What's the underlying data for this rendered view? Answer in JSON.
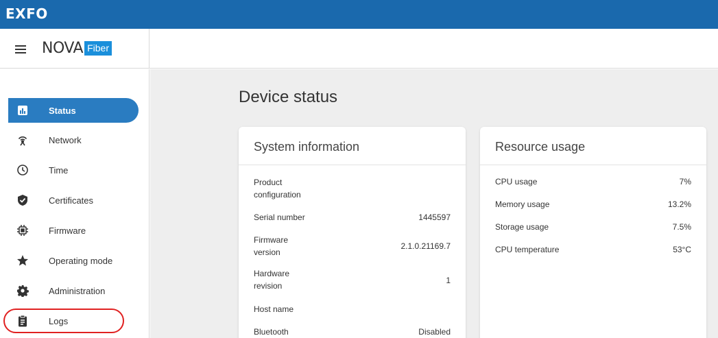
{
  "topbar": {
    "brand": "EXFO"
  },
  "header": {
    "logo_nova": "NOVA",
    "logo_fiber": "Fiber"
  },
  "sidebar": {
    "items": [
      {
        "label": "Status",
        "icon": "bar-chart-icon"
      },
      {
        "label": "Network",
        "icon": "antenna-icon"
      },
      {
        "label": "Time",
        "icon": "clock-icon"
      },
      {
        "label": "Certificates",
        "icon": "shield-check-icon"
      },
      {
        "label": "Firmware",
        "icon": "chip-icon"
      },
      {
        "label": "Operating mode",
        "icon": "star-icon"
      },
      {
        "label": "Administration",
        "icon": "gear-icon"
      },
      {
        "label": "Logs",
        "icon": "clipboard-icon"
      }
    ],
    "active_index": 0
  },
  "main": {
    "title": "Device status",
    "system": {
      "title": "System information",
      "rows": [
        {
          "label": "Product configuration",
          "value": ""
        },
        {
          "label": "Serial number",
          "value": "1445597"
        },
        {
          "label": "Firmware version",
          "value": "2.1.0.21169.7"
        },
        {
          "label": "Hardware revision",
          "value": "1"
        },
        {
          "label": "Host name",
          "value": ""
        },
        {
          "label": "Bluetooth",
          "value": "Disabled"
        }
      ]
    },
    "resource": {
      "title": "Resource usage",
      "rows": [
        {
          "label": "CPU usage",
          "value": "7%"
        },
        {
          "label": "Memory usage",
          "value": "13.2%"
        },
        {
          "label": "Storage usage",
          "value": "7.5%"
        },
        {
          "label": "CPU temperature",
          "value": "53°C"
        }
      ]
    }
  },
  "colors": {
    "topbar": "#1a69ad",
    "active": "#2a7cc1",
    "fiber_badge": "#1a8fdb",
    "highlight": "#e02020"
  }
}
